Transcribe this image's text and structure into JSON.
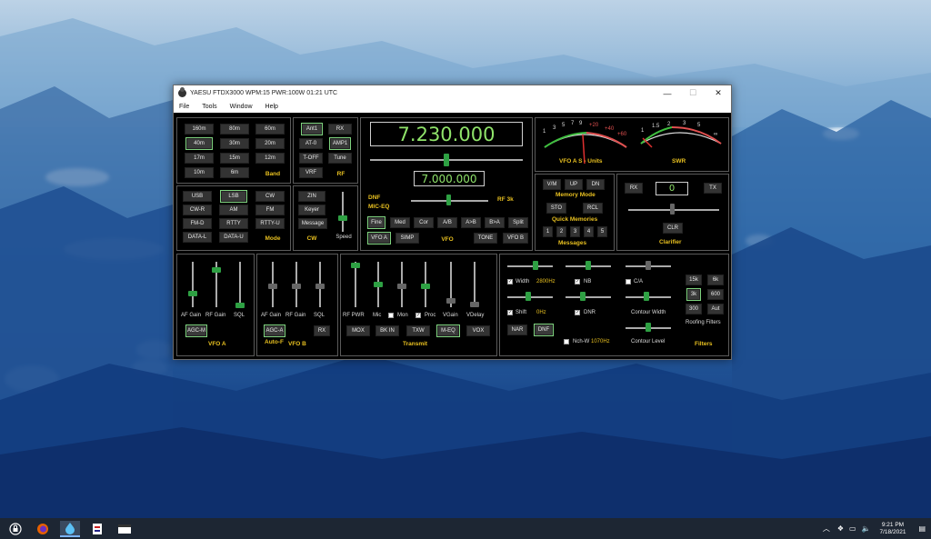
{
  "window": {
    "title": "YAESU FTDX3000 WPM:15 PWR:100W  01:21 UTC",
    "minimize": "—",
    "maximize": "☐",
    "close": "✕"
  },
  "menu": [
    "File",
    "Tools",
    "Window",
    "Help"
  ],
  "band": {
    "buttons": [
      "160m",
      "80m",
      "60m",
      "40m",
      "30m",
      "20m",
      "17m",
      "15m",
      "12m",
      "10m",
      "6m"
    ],
    "label": "Band"
  },
  "rf": {
    "buttons": [
      "Ant1",
      "RX",
      "AT-0",
      "AMP1",
      "T-OFF",
      "Tune",
      "VRF"
    ],
    "label": "RF"
  },
  "mode": {
    "buttons": [
      "USB",
      "LSB",
      "CW",
      "CW-R",
      "AM",
      "FM",
      "FM-D",
      "RTTY",
      "RTTY-U",
      "DATA-L",
      "DATA-U"
    ],
    "label": "Mode"
  },
  "cw": {
    "buttons": [
      "ZIN",
      "Keyer",
      "Message"
    ],
    "label": "CW",
    "speed": "Speed"
  },
  "vfo": {
    "freq_a": "7.230.000",
    "freq_b": "7.000.000",
    "dnf": "DNF",
    "miceq": "MIC-EQ",
    "rf3k": "RF 3k",
    "label": "VFO",
    "row1": [
      "Fine",
      "Med",
      "Cor",
      "A/B",
      "A>B",
      "B>A",
      "Split"
    ],
    "row2": [
      "VFO A",
      "SIMP",
      "TONE",
      "VFO B"
    ]
  },
  "meter": {
    "svals": [
      "1",
      "3",
      "5",
      "7",
      "9",
      "+20",
      "+40",
      "+60"
    ],
    "sunits": "VFO A S - Units",
    "swrvals": [
      "1",
      "1.5",
      "2",
      "3",
      "5",
      "∞"
    ],
    "swr": "SWR"
  },
  "memory": {
    "buttons": [
      "V/M",
      "UP",
      "DN",
      "STO",
      "RCL"
    ],
    "mode": "Memory Mode",
    "quick": "Quick Memories",
    "numbers": [
      "1",
      "2",
      "3",
      "4",
      "5"
    ],
    "label": "Messages"
  },
  "clarifier": {
    "rx": "RX",
    "value": "0",
    "tx": "TX",
    "clr": "CLR",
    "label": "Clarifier"
  },
  "vfoa_panel": {
    "sliders": [
      "AF Gain",
      "RF Gain",
      "SQL"
    ],
    "agc": "AGC-M",
    "label": "VFO A"
  },
  "vfob_panel": {
    "sliders": [
      "AF Gain",
      "RF Gain",
      "SQL"
    ],
    "agc": "AGC-A",
    "autof": "Auto-F",
    "rx": "RX",
    "label": "VFO B"
  },
  "transmit": {
    "sliders": [
      "RF PWR",
      "Mic",
      "Mon",
      "Proc",
      "VGain",
      "VDelay"
    ],
    "buttons": [
      "MOX",
      "BK IN",
      "TXW",
      "M-EQ",
      "VOX"
    ],
    "label": "Transmit"
  },
  "filters": {
    "width": "Width",
    "width_val": "2800Hz",
    "shift": "Shift",
    "shift_val": "0Hz",
    "nb": "NB",
    "dnr": "DNR",
    "ca": "C/A",
    "contour_width": "Contour Width",
    "contour_level": "Contour Level",
    "nar": "NAR",
    "dnf": "DNF",
    "nchw": "Nch-W",
    "nchw_val": "1070Hz",
    "roofing": [
      "15k",
      "6k",
      "3k",
      "600",
      "300",
      "Aut"
    ],
    "roofing_label": "Roofing Filters",
    "label": "Filters"
  },
  "taskbar": {
    "time": "9:21 PM",
    "date": "7/18/2021"
  },
  "colors": {
    "accent": "#e8c020",
    "freq": "#8fe36a",
    "thumb": "#2ea043"
  }
}
